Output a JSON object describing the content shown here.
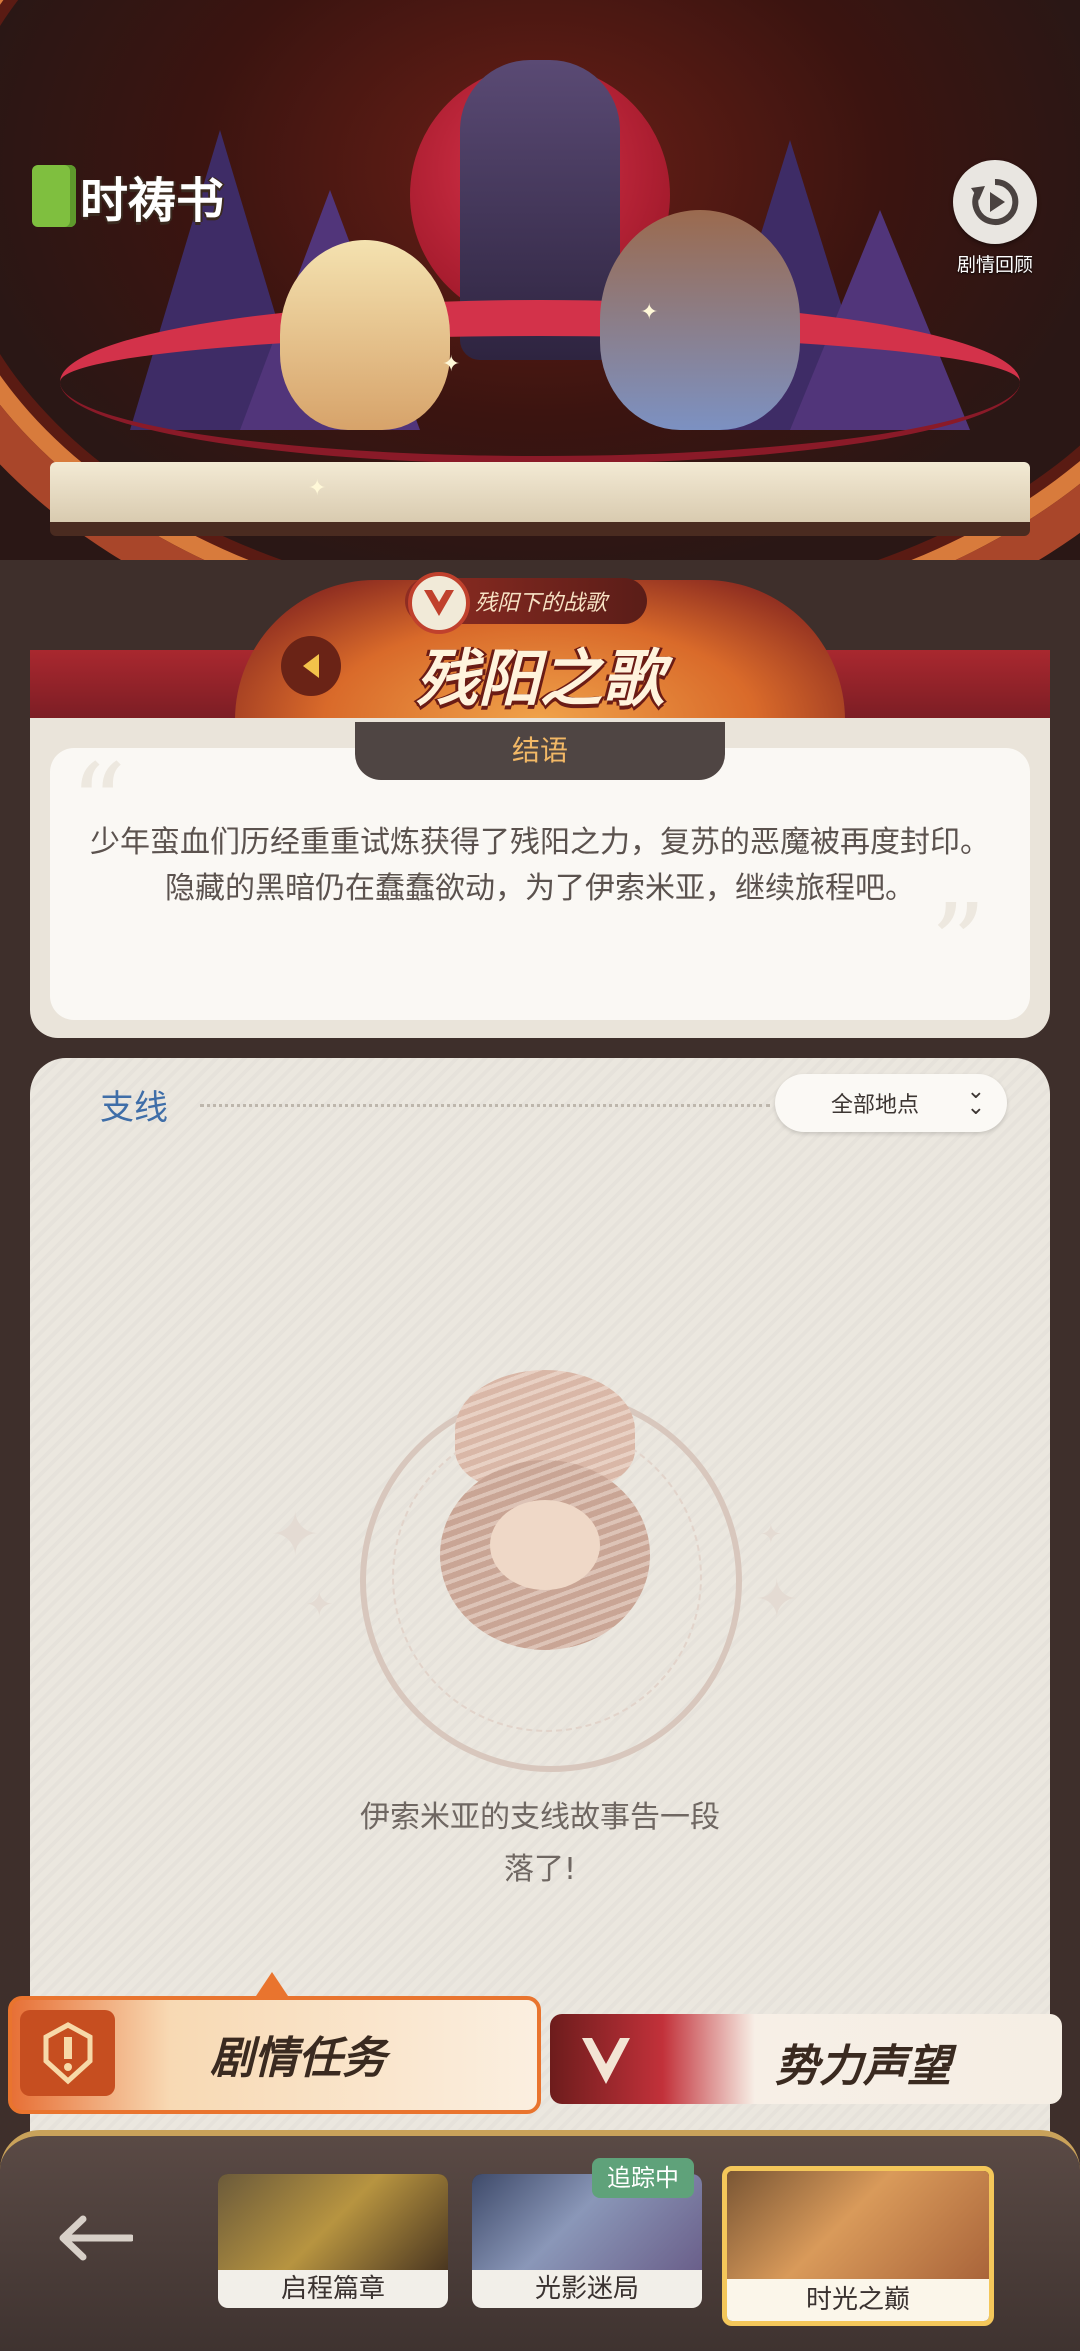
{
  "header": {
    "logo_text": "时祷书",
    "replay_label": "剧情回顾"
  },
  "chapter": {
    "subtitle": "残阳下的战歌",
    "title": "残阳之歌"
  },
  "epilogue": {
    "tab_label": "结语",
    "text": "少年蛮血们历经重重试炼获得了残阳之力，复苏的恶魔被再度封印。隐藏的黑暗仍在蠢蠢欲动，为了伊索米亚，继续旅程吧。"
  },
  "side_quests": {
    "title": "支线",
    "filter_label": "全部地点",
    "empty_text_line1": "伊索米亚的支线故事告一段",
    "empty_text_line2": "落了!"
  },
  "tabs": [
    {
      "label": "剧情任务",
      "selected": true
    },
    {
      "label": "势力声望",
      "selected": false
    }
  ],
  "footer": {
    "cards": [
      {
        "label": "启程篇章",
        "selected": false
      },
      {
        "label": "光影迷局",
        "selected": false,
        "badge": "追踪中"
      },
      {
        "label": "时光之巅",
        "selected": true
      }
    ]
  },
  "colors": {
    "accent_orange": "#e9742e",
    "title_blue": "#3f6ea8",
    "tracking_green": "#5fa27a",
    "epilogue_tab_text": "#f2b866"
  }
}
